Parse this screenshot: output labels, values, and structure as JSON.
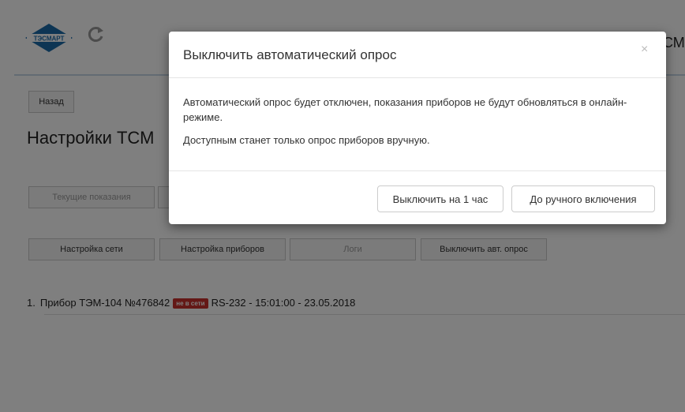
{
  "header": {
    "logo_text": "ТЭСМАРТ",
    "brand_right": "СМ"
  },
  "nav": {
    "back_label": "Назад"
  },
  "page_title": "Настройки ТСМ",
  "tabs_row1": [
    {
      "label": "Текущие показания"
    }
  ],
  "tabs_row2": [
    {
      "label": "Настройка сети"
    },
    {
      "label": "Настройка приборов"
    },
    {
      "label": "Логи"
    },
    {
      "label": "Выключить авт. опрос"
    }
  ],
  "devices": [
    {
      "index": "1.",
      "name": "Прибор ТЭМ-104 №476842",
      "status": "не в сети",
      "details": "RS-232 - 15:01:00 - 23.05.2018"
    }
  ],
  "modal": {
    "title": "Выключить автоматический опрос",
    "close": "×",
    "body": [
      "Автоматический опрос будет отключен, показания приборов не будут обновляться в онлайн-режиме.",
      "Доступным станет только опрос приборов вручную."
    ],
    "buttons": {
      "one_hour": "Выключить на 1 час",
      "until_manual": "До ручного включения"
    }
  },
  "colors": {
    "badge": "#c9302c",
    "logo_blue": "#1a6aa8",
    "backdrop": "rgba(0,0,0,0.5)"
  }
}
